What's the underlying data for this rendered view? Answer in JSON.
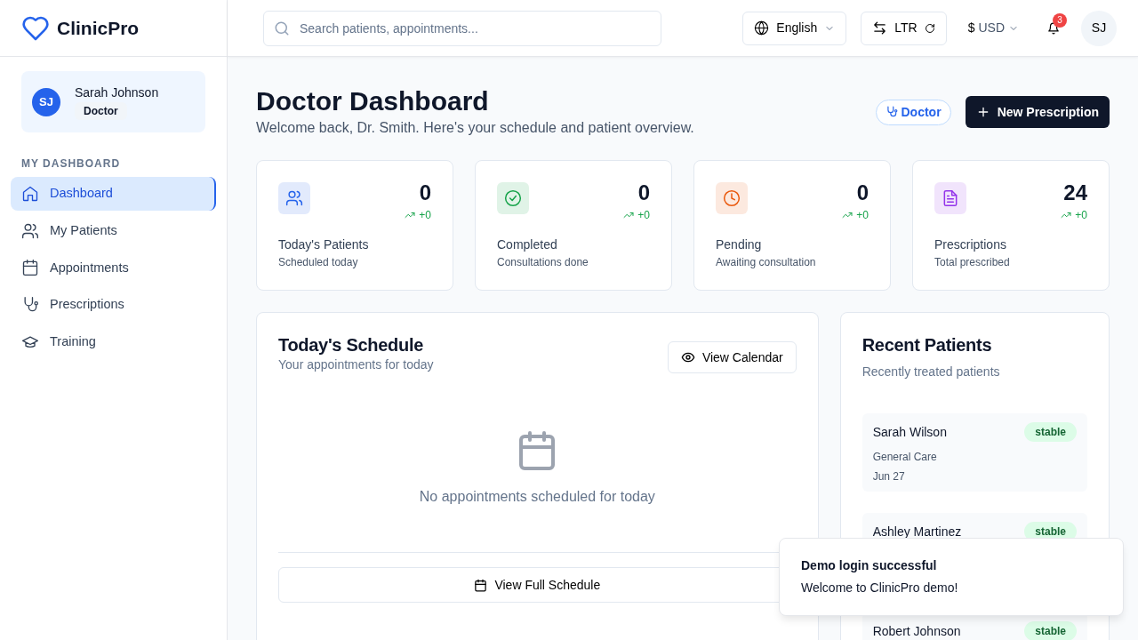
{
  "brand": {
    "name": "ClinicPro"
  },
  "user_card": {
    "initials": "SJ",
    "name": "Sarah Johnson",
    "role": "Doctor"
  },
  "sidebar": {
    "section": "MY DASHBOARD",
    "items": [
      {
        "label": "Dashboard",
        "selected": true
      },
      {
        "label": "My Patients",
        "selected": false
      },
      {
        "label": "Appointments",
        "selected": false
      },
      {
        "label": "Prescriptions",
        "selected": false
      },
      {
        "label": "Training",
        "selected": false
      }
    ]
  },
  "topbar": {
    "search": {
      "placeholder": "Search patients, appointments..."
    },
    "language": "English",
    "direction": "LTR",
    "currency_symbol": "$",
    "currency": "USD",
    "notifications": "3",
    "avatar": "SJ"
  },
  "page": {
    "title": "Doctor Dashboard",
    "subtitle": "Welcome back, Dr. Smith. Here's your schedule and patient overview.",
    "role_badge": "Doctor",
    "action": "New Prescription"
  },
  "stats": [
    {
      "color": "#2563eb",
      "value": "0",
      "change": "+0",
      "label": "Today's Patients",
      "sub": "Scheduled today"
    },
    {
      "color": "#16a34a",
      "value": "0",
      "change": "+0",
      "label": "Completed",
      "sub": "Consultations done"
    },
    {
      "color": "#ea580c",
      "value": "0",
      "change": "+0",
      "label": "Pending",
      "sub": "Awaiting consultation"
    },
    {
      "color": "#9333ea",
      "value": "24",
      "change": "+0",
      "label": "Prescriptions",
      "sub": "Total prescribed"
    }
  ],
  "schedule": {
    "title": "Today's Schedule",
    "subtitle": "Your appointments for today",
    "view_button": "View Calendar",
    "empty": "No appointments scheduled for today",
    "full_button": "View Full Schedule"
  },
  "recent": {
    "title": "Recent Patients",
    "subtitle": "Recently treated patients",
    "patients": [
      {
        "name": "Sarah Wilson",
        "status": "stable",
        "department": "General Care",
        "date": "Jun 27"
      },
      {
        "name": "Ashley Martinez",
        "status": "stable"
      },
      {
        "name": "Robert Johnson",
        "status": "stable"
      }
    ]
  },
  "toast": {
    "title": "Demo login successful",
    "message": "Welcome to ClinicPro demo!"
  }
}
